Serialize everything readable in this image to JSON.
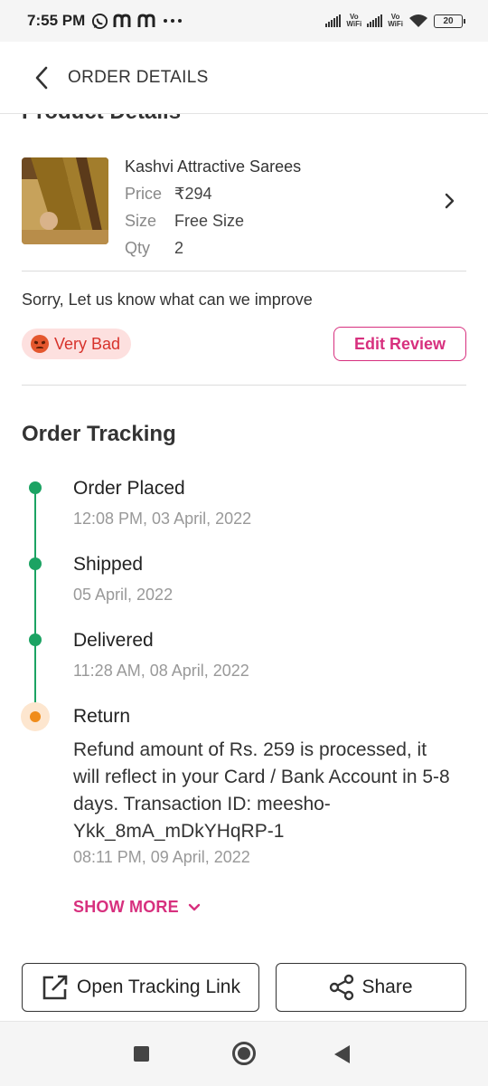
{
  "status_bar": {
    "time": "7:55 PM",
    "left_icons": [
      "whatsapp-icon",
      "meesho-m-icon",
      "meesho-m-icon",
      "more-dots-icon"
    ],
    "vo_wifi_label": "Vo WiFi",
    "battery": "20"
  },
  "header": {
    "title": "ORDER DETAILS"
  },
  "product_section": {
    "heading": "Product Details",
    "name": "Kashvi Attractive Sarees",
    "price_label": "Price",
    "price_value": "₹294",
    "size_label": "Size",
    "size_value": "Free Size",
    "qty_label": "Qty",
    "qty_value": "2"
  },
  "feedback": {
    "prompt": "Sorry, Let us know what can we improve",
    "rating_label": "Very Bad",
    "edit_label": "Edit Review"
  },
  "tracking": {
    "title": "Order Tracking",
    "steps": [
      {
        "title": "Order Placed",
        "time": "12:08 PM, 03 April, 2022"
      },
      {
        "title": "Shipped",
        "time": "05 April, 2022"
      },
      {
        "title": "Delivered",
        "time": "11:28 AM, 08 April, 2022"
      },
      {
        "title": "Return",
        "description": "Refund amount of Rs. 259 is processed, it will reflect in your Card / Bank Account in 5-8 days. Transaction ID: meesho-Ykk_8mA_mDkYHqRP-1",
        "time": "08:11 PM, 09 April, 2022"
      }
    ],
    "show_more_label": "SHOW MORE"
  },
  "actions": {
    "open_tracking_label": "Open Tracking Link",
    "share_label": "Share"
  },
  "colors": {
    "accent": "#d7307e",
    "complete": "#1ca363",
    "pending": "#f08c1a",
    "bad_rating_bg": "#fde0df",
    "bad_rating_text": "#d7322b"
  }
}
